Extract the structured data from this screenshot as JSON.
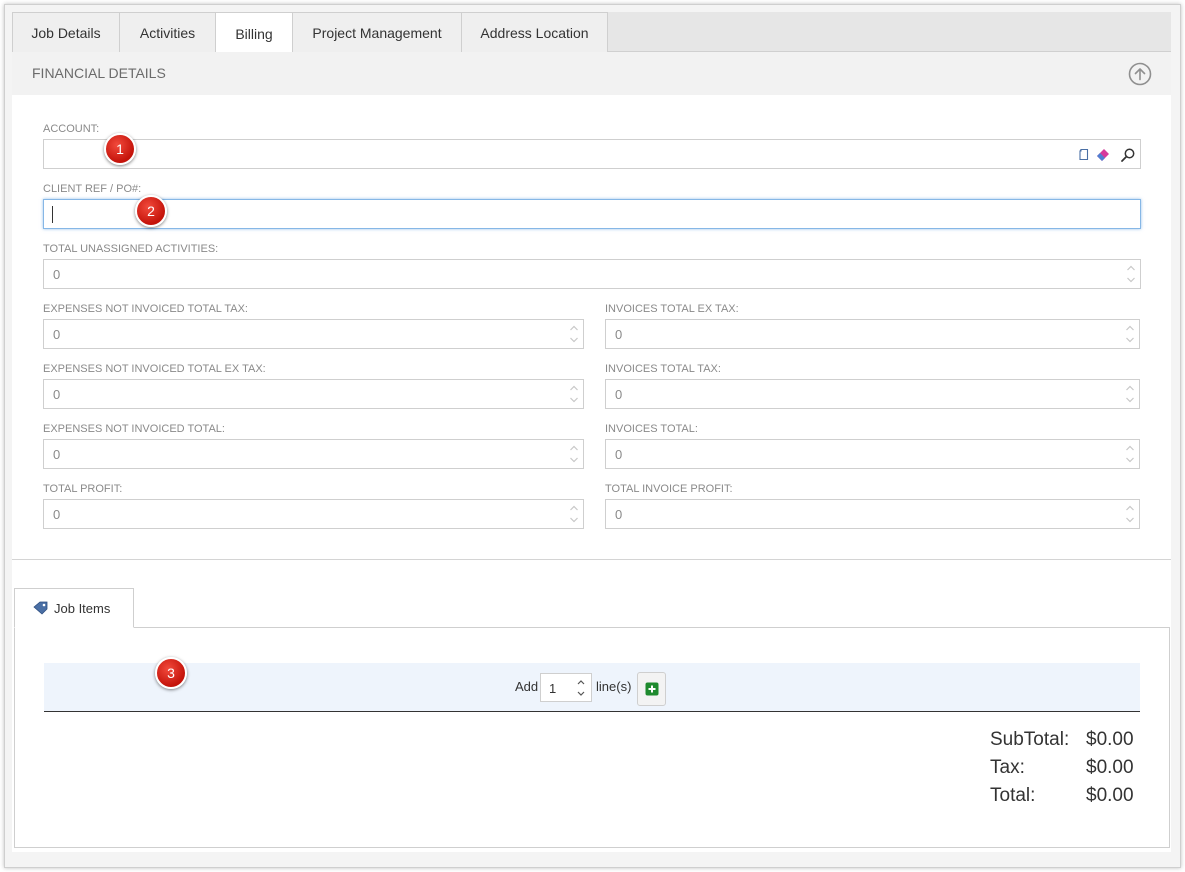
{
  "tabs": [
    "Job Details",
    "Activities",
    "Billing",
    "Project Management",
    "Address Location"
  ],
  "active_tab": "Billing",
  "section_title": "FINANCIAL DETAILS",
  "account": {
    "label": "ACCOUNT:",
    "value": ""
  },
  "client_ref": {
    "label": "CLIENT REF / PO#:",
    "value": ""
  },
  "total_unassigned": {
    "label": "TOTAL UNASSIGNED ACTIVITIES:",
    "value": "0"
  },
  "left_fields": [
    {
      "label": "EXPENSES NOT INVOICED TOTAL TAX:",
      "value": "0"
    },
    {
      "label": "EXPENSES NOT INVOICED TOTAL EX TAX:",
      "value": "0"
    },
    {
      "label": "EXPENSES NOT INVOICED TOTAL:",
      "value": "0"
    },
    {
      "label": "TOTAL PROFIT:",
      "value": "0"
    }
  ],
  "right_fields": [
    {
      "label": "INVOICES TOTAL EX TAX:",
      "value": "0"
    },
    {
      "label": "INVOICES TOTAL TAX:",
      "value": "0"
    },
    {
      "label": "INVOICES TOTAL:",
      "value": "0"
    },
    {
      "label": "TOTAL INVOICE PROFIT:",
      "value": "0"
    }
  ],
  "badges": [
    "1",
    "2",
    "3"
  ],
  "job_items": {
    "tab_label": "Job Items",
    "add_label": "Add",
    "add_count": "1",
    "lines_label": "line(s)"
  },
  "totals": {
    "subtotal_label": "SubTotal:",
    "subtotal": "$0.00",
    "tax_label": "Tax:",
    "tax": "$0.00",
    "total_label": "Total:",
    "total": "$0.00"
  },
  "colors": {
    "badge": "#d61a10",
    "add_button": "#1e8a2e",
    "focus": "#86b7e6"
  }
}
